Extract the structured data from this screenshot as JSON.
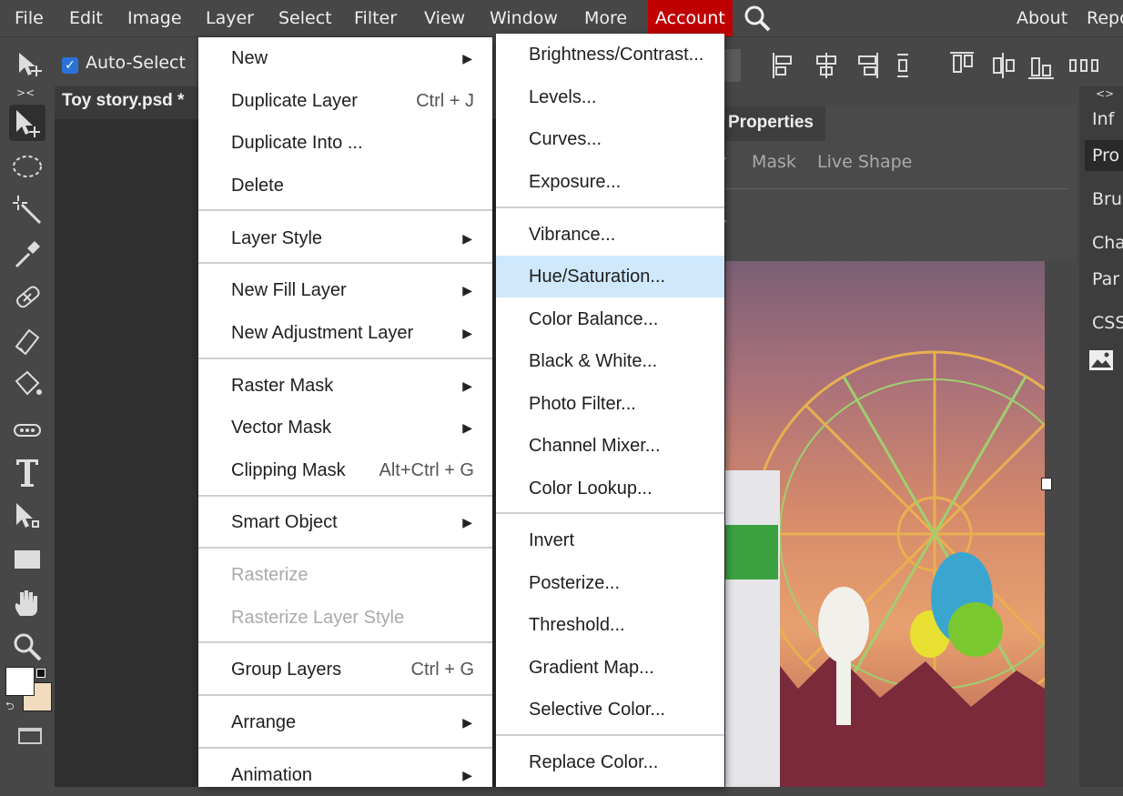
{
  "menubar": {
    "items": [
      "File",
      "Edit",
      "Image",
      "Layer",
      "Select",
      "Filter",
      "View",
      "Window",
      "More",
      "Account"
    ],
    "right": [
      "About",
      "Repo"
    ]
  },
  "options": {
    "auto_select": "Auto-Select",
    "checked": true
  },
  "document": {
    "title": "Toy story.psd *"
  },
  "properties": {
    "title": "Properties",
    "tabs": [
      "r",
      "Mask",
      "Live Shape"
    ],
    "row_fragment": "r"
  },
  "right_panel": {
    "items": [
      "Inf",
      "Pro",
      "Bru",
      "Cha",
      "Par",
      "CSS"
    ]
  },
  "layer_menu": {
    "items": [
      {
        "label": "New",
        "shortcut": "",
        "submenu": true,
        "disabled": false
      },
      {
        "label": "Duplicate Layer",
        "shortcut": "Ctrl + J",
        "submenu": false,
        "disabled": false
      },
      {
        "label": "Duplicate Into ...",
        "shortcut": "",
        "submenu": false,
        "disabled": false
      },
      {
        "label": "Delete",
        "shortcut": "",
        "submenu": false,
        "disabled": false
      },
      {
        "label": "Layer Style",
        "shortcut": "",
        "submenu": true,
        "disabled": false
      },
      {
        "label": "New Fill Layer",
        "shortcut": "",
        "submenu": true,
        "disabled": false
      },
      {
        "label": "New Adjustment Layer",
        "shortcut": "",
        "submenu": true,
        "disabled": false
      },
      {
        "label": "Raster Mask",
        "shortcut": "",
        "submenu": true,
        "disabled": false
      },
      {
        "label": "Vector Mask",
        "shortcut": "",
        "submenu": true,
        "disabled": false
      },
      {
        "label": "Clipping Mask",
        "shortcut": "Alt+Ctrl + G",
        "submenu": false,
        "disabled": false
      },
      {
        "label": "Smart Object",
        "shortcut": "",
        "submenu": true,
        "disabled": false
      },
      {
        "label": "Rasterize",
        "shortcut": "",
        "submenu": false,
        "disabled": true
      },
      {
        "label": "Rasterize Layer Style",
        "shortcut": "",
        "submenu": false,
        "disabled": true
      },
      {
        "label": "Group Layers",
        "shortcut": "Ctrl + G",
        "submenu": false,
        "disabled": false
      },
      {
        "label": "Arrange",
        "shortcut": "",
        "submenu": true,
        "disabled": false
      },
      {
        "label": "Animation",
        "shortcut": "",
        "submenu": true,
        "disabled": false
      }
    ]
  },
  "adjust_menu": {
    "items": [
      {
        "label": "Brightness/Contrast...",
        "highlighted": false
      },
      {
        "label": "Levels...",
        "highlighted": false
      },
      {
        "label": "Curves...",
        "highlighted": false
      },
      {
        "label": "Exposure...",
        "highlighted": false
      },
      {
        "label": "Vibrance...",
        "highlighted": false
      },
      {
        "label": "Hue/Saturation...",
        "highlighted": true
      },
      {
        "label": "Color Balance...",
        "highlighted": false
      },
      {
        "label": "Black & White...",
        "highlighted": false
      },
      {
        "label": "Photo Filter...",
        "highlighted": false
      },
      {
        "label": "Channel Mixer...",
        "highlighted": false
      },
      {
        "label": "Color Lookup...",
        "highlighted": false
      },
      {
        "label": "Invert",
        "highlighted": false
      },
      {
        "label": "Posterize...",
        "highlighted": false
      },
      {
        "label": "Threshold...",
        "highlighted": false
      },
      {
        "label": "Gradient Map...",
        "highlighted": false
      },
      {
        "label": "Selective Color...",
        "highlighted": false
      },
      {
        "label": "Replace Color...",
        "highlighted": false
      }
    ]
  },
  "colors": {
    "accent": "#c00000",
    "highlight": "#cfe8fb",
    "fg_swatch": "#ffffff",
    "bg_swatch": "#f2dcc0"
  }
}
